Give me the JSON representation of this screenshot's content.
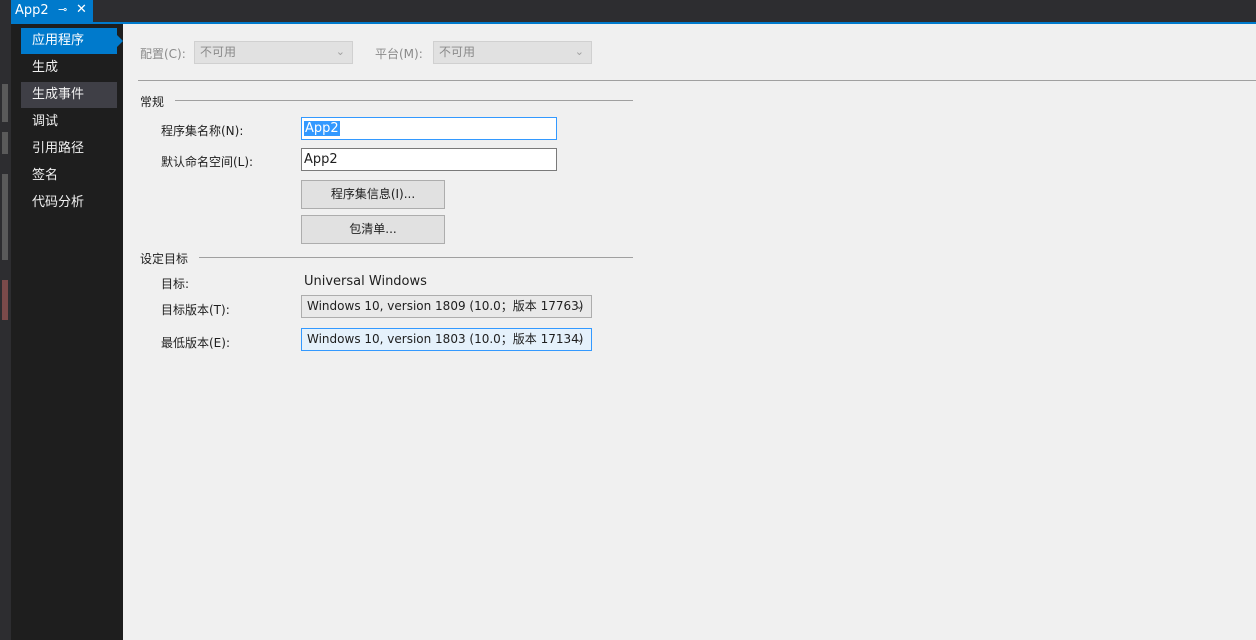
{
  "tab": {
    "title": "App2",
    "pin_glyph": "⊸",
    "close_glyph": "✕"
  },
  "sidebar": {
    "items": [
      {
        "label": "应用程序"
      },
      {
        "label": "生成"
      },
      {
        "label": "生成事件"
      },
      {
        "label": "调试"
      },
      {
        "label": "引用路径"
      },
      {
        "label": "签名"
      },
      {
        "label": "代码分析"
      }
    ]
  },
  "toolbar": {
    "config_label": "配置(C):",
    "config_value": "不可用",
    "platform_label": "平台(M):",
    "platform_value": "不可用"
  },
  "general": {
    "section_title": "常规",
    "assembly_name_label": "程序集名称(N):",
    "assembly_name_value": "App2",
    "default_namespace_label": "默认命名空间(L):",
    "default_namespace_value": "App2",
    "assembly_info_button": "程序集信息(I)...",
    "package_manifest_button": "包清单..."
  },
  "targeting": {
    "section_title": "设定目标",
    "target_label": "目标:",
    "target_value": "Universal Windows",
    "target_version_label": "目标版本(T):",
    "target_version_value": "Windows 10, version 1809 (10.0；版本 17763)",
    "min_version_label": "最低版本(E):",
    "min_version_value": "Windows 10, version 1803 (10.0；版本 17134)"
  },
  "colors": {
    "accent": "#007acc",
    "sidebar_bg": "#1e1e1e",
    "content_bg": "#f0f0f0"
  },
  "icons": {
    "dropdown": "chevron-down-icon",
    "close": "close-icon",
    "pin": "pin-icon"
  }
}
